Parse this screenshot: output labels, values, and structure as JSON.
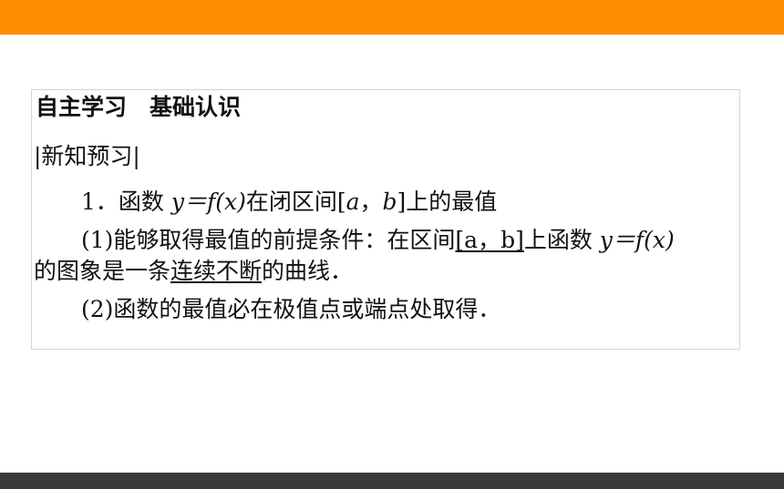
{
  "colors": {
    "top_bar": "#ff8c00",
    "bottom_bar": "#3a3a3a"
  },
  "section_title": "自主学习　基础认识",
  "sub_heading": "|新知预习|",
  "item1": {
    "number": "1．",
    "text_a": "函数 ",
    "math": "y＝f(x)",
    "text_b": "在闭区间[",
    "a": "a",
    "comma": "，",
    "b": "b",
    "text_c": "]上的最值"
  },
  "para1": {
    "lead": "(1)能够取得最值的前提条件：在区间",
    "interval": "[a，b]",
    "mid": "上函数 ",
    "math": "y＝f(x)",
    "line2_pre": "的图象是一条",
    "underlined": "连续不断",
    "line2_post": "的曲线．"
  },
  "para2": "(2)函数的最值必在极值点或端点处取得．"
}
